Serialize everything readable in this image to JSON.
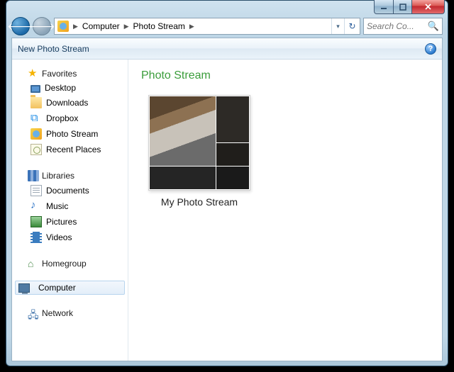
{
  "breadcrumb": {
    "root": "Computer",
    "current": "Photo Stream"
  },
  "search": {
    "placeholder": "Search Co..."
  },
  "toolbar": {
    "new_btn": "New Photo Stream"
  },
  "nav": {
    "favorites": {
      "label": "Favorites",
      "items": [
        "Desktop",
        "Downloads",
        "Dropbox",
        "Photo Stream",
        "Recent Places"
      ]
    },
    "libraries": {
      "label": "Libraries",
      "items": [
        "Documents",
        "Music",
        "Pictures",
        "Videos"
      ]
    },
    "homegroup": "Homegroup",
    "computer": "Computer",
    "network": "Network"
  },
  "content": {
    "heading": "Photo Stream",
    "heading_color": "#3b9d3b",
    "album_title": "My Photo Stream"
  }
}
